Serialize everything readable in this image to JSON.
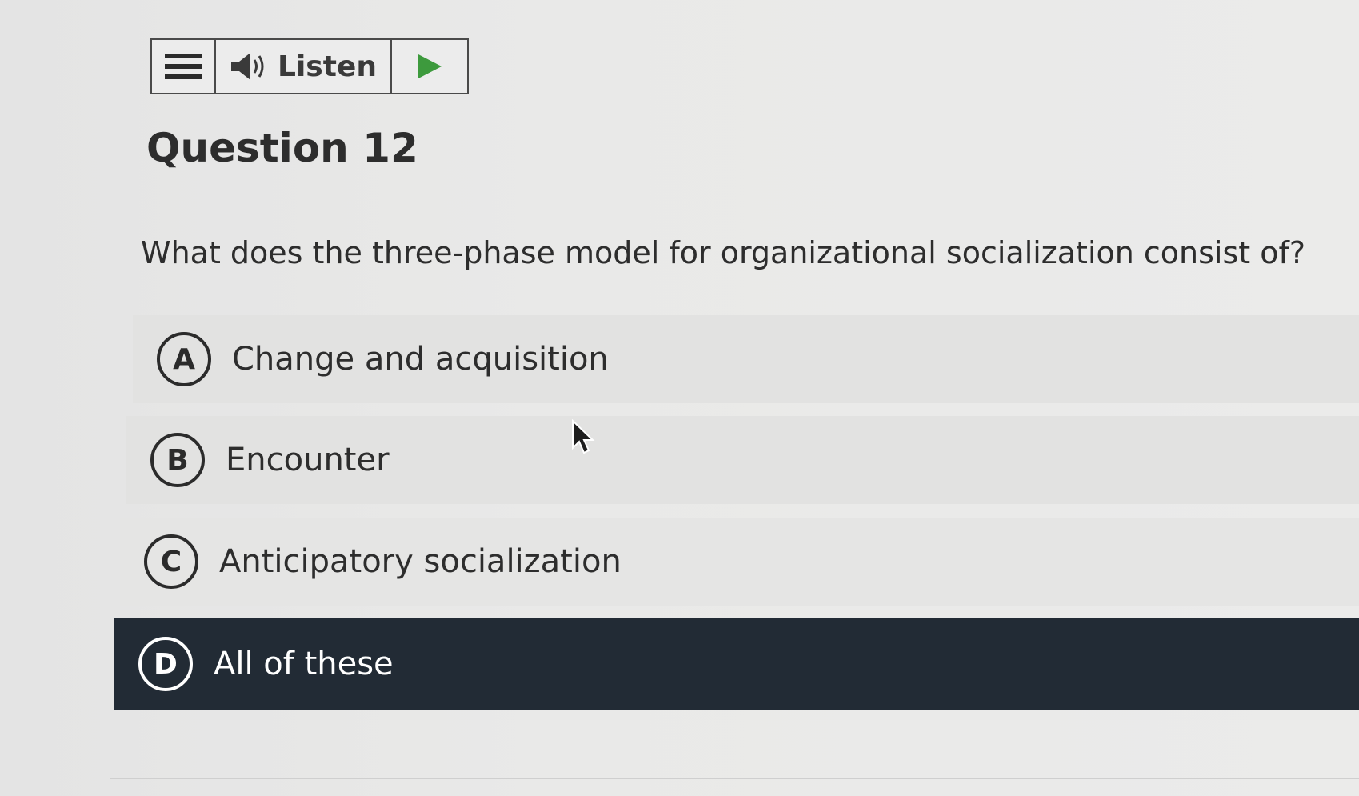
{
  "toolbar": {
    "menu_icon": "hamburger-icon",
    "speaker_icon": "speaker-icon",
    "listen_label": "Listen",
    "play_icon": "play-icon",
    "play_color": "#3d9a3d"
  },
  "question": {
    "title": "Question 12",
    "text": "What does the three-phase model for organizational socialization consist of?"
  },
  "options": [
    {
      "letter": "A",
      "label": "Change and acquisition",
      "selected": false
    },
    {
      "letter": "B",
      "label": "Encounter",
      "selected": false
    },
    {
      "letter": "C",
      "label": "Anticipatory socialization",
      "selected": false
    },
    {
      "letter": "D",
      "label": "All of these",
      "selected": true
    }
  ],
  "colors": {
    "selected_background": "#222b35",
    "page_background": "#e9e9e8"
  }
}
